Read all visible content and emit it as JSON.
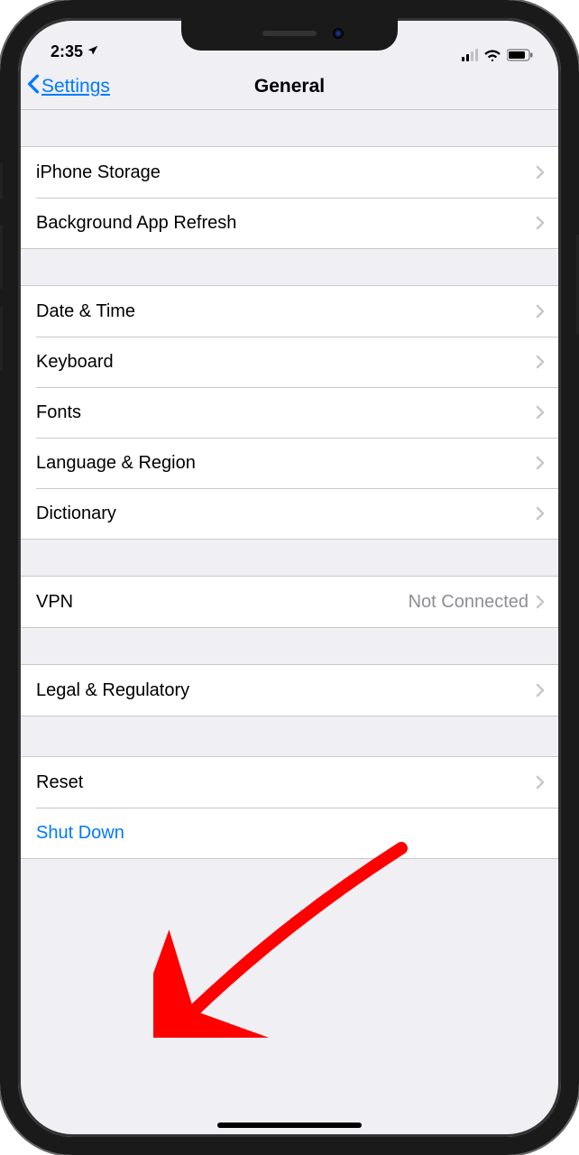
{
  "status": {
    "time": "2:35",
    "location_icon": "location-arrow-icon"
  },
  "nav": {
    "back_label": "Settings",
    "title": "General"
  },
  "groups": [
    {
      "rows": [
        {
          "id": "iphone-storage",
          "label": "iPhone Storage"
        },
        {
          "id": "background-app-refresh",
          "label": "Background App Refresh"
        }
      ]
    },
    {
      "rows": [
        {
          "id": "date-time",
          "label": "Date & Time"
        },
        {
          "id": "keyboard",
          "label": "Keyboard"
        },
        {
          "id": "fonts",
          "label": "Fonts"
        },
        {
          "id": "language-region",
          "label": "Language & Region"
        },
        {
          "id": "dictionary",
          "label": "Dictionary"
        }
      ]
    },
    {
      "rows": [
        {
          "id": "vpn",
          "label": "VPN",
          "detail": "Not Connected"
        }
      ]
    },
    {
      "rows": [
        {
          "id": "legal-regulatory",
          "label": "Legal & Regulatory"
        }
      ]
    },
    {
      "rows": [
        {
          "id": "reset",
          "label": "Reset"
        },
        {
          "id": "shut-down",
          "label": "Shut Down",
          "link": true,
          "no_chevron": true
        }
      ]
    }
  ],
  "annotation": {
    "type": "arrow",
    "color": "#ff0000",
    "target": "shut-down"
  }
}
